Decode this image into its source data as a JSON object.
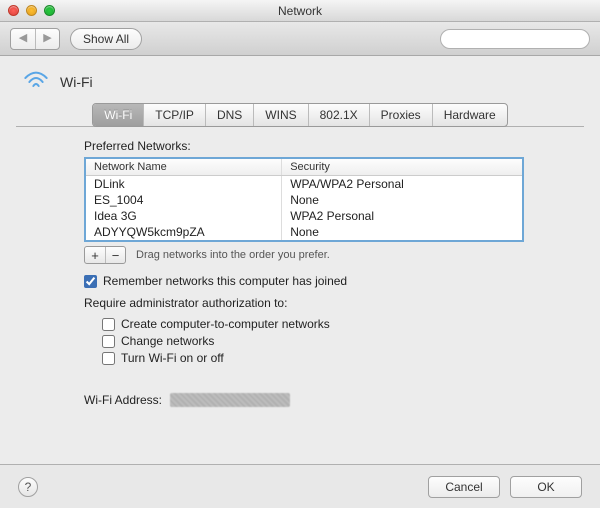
{
  "window": {
    "title": "Network"
  },
  "toolbar": {
    "show_all": "Show All",
    "search_placeholder": ""
  },
  "header": {
    "title": "Wi-Fi"
  },
  "tabs": [
    "Wi-Fi",
    "TCP/IP",
    "DNS",
    "WINS",
    "802.1X",
    "Proxies",
    "Hardware"
  ],
  "networks": {
    "label": "Preferred Networks:",
    "cols": {
      "name": "Network Name",
      "security": "Security"
    },
    "rows": [
      {
        "name": "DLink",
        "security": "WPA/WPA2 Personal"
      },
      {
        "name": "ES_1004",
        "security": "None"
      },
      {
        "name": "Idea 3G",
        "security": "WPA2 Personal"
      },
      {
        "name": "ADYYQW5kcm9pZA",
        "security": "None"
      }
    ],
    "hint": "Drag networks into the order you prefer."
  },
  "remember": {
    "label": "Remember networks this computer has joined",
    "checked": true
  },
  "admin": {
    "label": "Require administrator authorization to:",
    "opts": {
      "create": "Create computer-to-computer networks",
      "change": "Change networks",
      "toggle": "Turn Wi-Fi on or off"
    }
  },
  "wifi_address_label": "Wi-Fi Address:",
  "buttons": {
    "cancel": "Cancel",
    "ok": "OK",
    "plus": "+",
    "minus": "−"
  }
}
